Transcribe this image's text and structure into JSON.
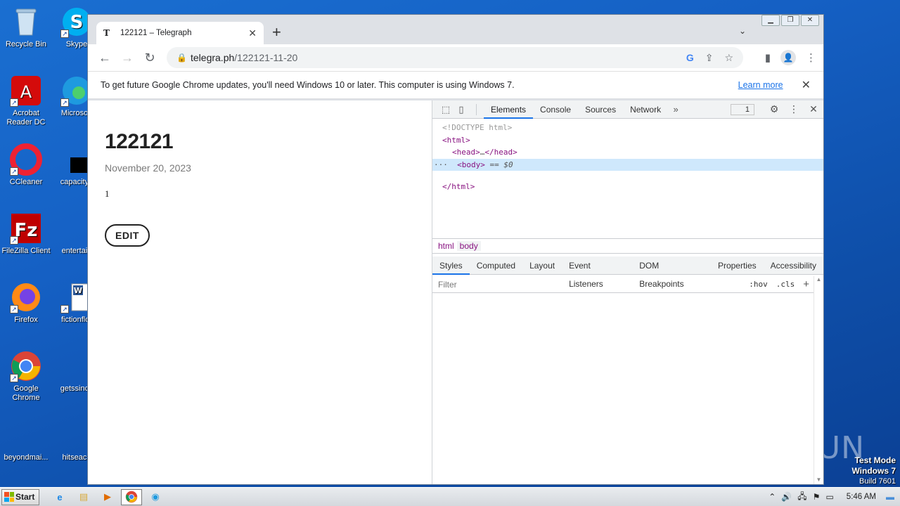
{
  "desktop": {
    "icons": [
      {
        "label": "Recycle Bin"
      },
      {
        "label": "Skype"
      },
      {
        "label": "Acrobat Reader DC"
      },
      {
        "label": "Microsoft"
      },
      {
        "label": "CCleaner"
      },
      {
        "label": "capacityb"
      },
      {
        "label": "FileZilla Client"
      },
      {
        "label": "entertain"
      },
      {
        "label": "Firefox"
      },
      {
        "label": "fictionflor"
      },
      {
        "label": "Google Chrome"
      },
      {
        "label": "getssince"
      },
      {
        "label": "beyondmai..."
      },
      {
        "label": "hitseach"
      }
    ],
    "watermark": "ANY RUN",
    "test_mode": {
      "line1": "Test Mode",
      "line2": "Windows 7",
      "line3": "Build 7601"
    }
  },
  "browser": {
    "tab": {
      "favicon": "T",
      "title": "122121 – Telegraph"
    },
    "omnibox": {
      "host": "telegra.ph",
      "path": "/122121-11-20"
    },
    "infobar": {
      "message": "To get future Google Chrome updates, you'll need Windows 10 or later. This computer is using Windows 7.",
      "learn_more": "Learn more"
    }
  },
  "page": {
    "title": "122121",
    "date": "November 20, 2023",
    "content": "1",
    "edit_button": "EDIT"
  },
  "devtools": {
    "tabs": [
      "Elements",
      "Console",
      "Sources",
      "Network"
    ],
    "issues_count": "1",
    "dom": {
      "doctype": "<!DOCTYPE html>",
      "html_open": "<html>",
      "head": "<head>",
      "head_ellipsis": "…",
      "head_close": "</head>",
      "body": "<body>",
      "eq": "==",
      "dollar": "$0",
      "html_close": "</html>"
    },
    "breadcrumbs": [
      "html",
      "body"
    ],
    "style_tabs": [
      "Styles",
      "Computed",
      "Layout",
      "Event Listeners",
      "DOM Breakpoints",
      "Properties",
      "Accessibility"
    ],
    "filter_placeholder": "Filter",
    "hov": ":hov",
    "cls": ".cls"
  },
  "taskbar": {
    "start_label": "Start",
    "clock": "5:46 AM"
  }
}
